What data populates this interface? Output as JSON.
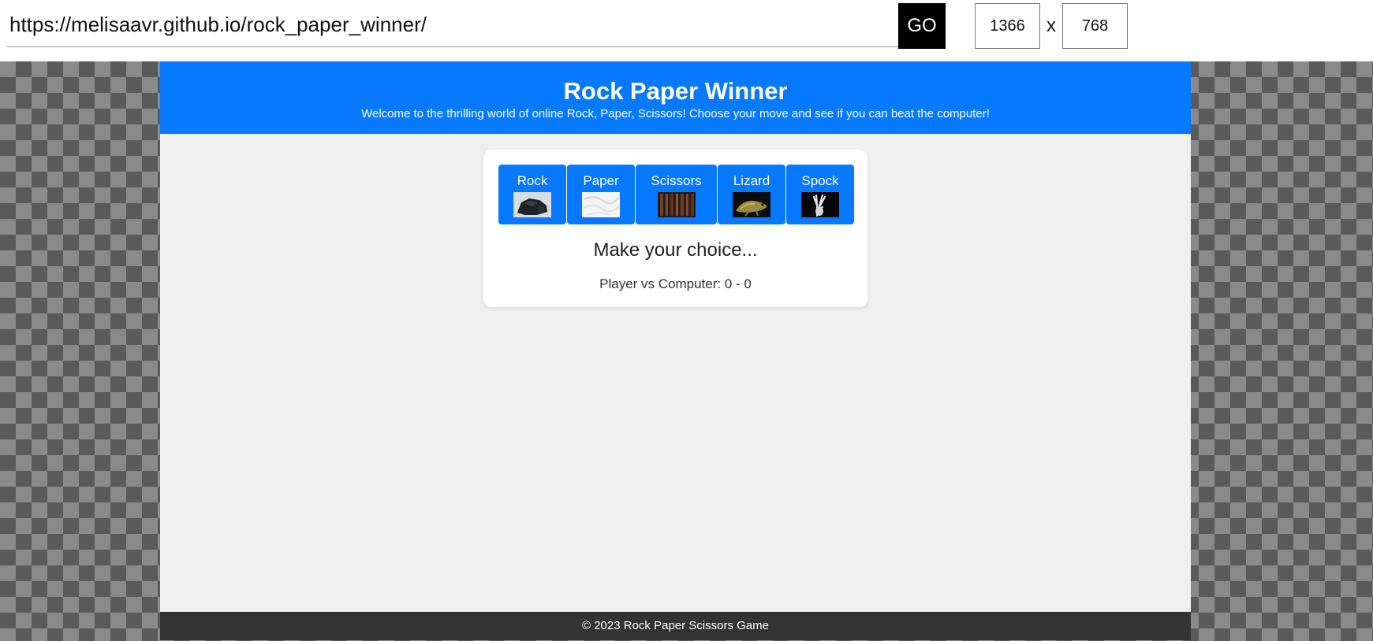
{
  "browser": {
    "url": "https://melisaavr.github.io/rock_paper_winner/",
    "go_label": "GO",
    "width": "1366",
    "height": "768",
    "separator": "x"
  },
  "header": {
    "title": "Rock Paper Winner",
    "subtitle": "Welcome to the thrilling world of online Rock, Paper, Scissors! Choose your move and see if you can beat the computer!"
  },
  "game": {
    "choices": [
      {
        "label": "Rock",
        "icon": "rock-image"
      },
      {
        "label": "Paper",
        "icon": "paper-image"
      },
      {
        "label": "Scissors",
        "icon": "scissors-image"
      },
      {
        "label": "Lizard",
        "icon": "lizard-image"
      },
      {
        "label": "Spock",
        "icon": "spock-hand-image"
      }
    ],
    "message": "Make your choice...",
    "score": "Player vs Computer: 0 - 0"
  },
  "footer": {
    "text": "© 2023 Rock Paper Scissors Game"
  },
  "colors": {
    "primary": "#0779ff",
    "footer": "#333333",
    "page_bg": "#efefef"
  }
}
